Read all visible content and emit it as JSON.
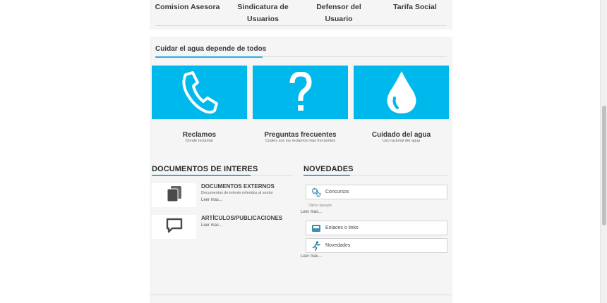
{
  "top_nav": {
    "items": [
      {
        "label": "Comision Asesora"
      },
      {
        "label": "Sindicatura de Usuarios"
      },
      {
        "label": "Defensor del Usuario"
      },
      {
        "label": "Tarifa Social"
      }
    ]
  },
  "care": {
    "title": "Cuidar el agua depende de todos",
    "cards": [
      {
        "icon": "phone-icon",
        "title": "Reclamos",
        "subtitle": "Donde reclamar"
      },
      {
        "icon": "question-icon",
        "title": "Preguntas frecuentes",
        "subtitle": "Cuales son los reclamos mas frecuentes"
      },
      {
        "icon": "water-drop-icon",
        "title": "Cuidado del agua",
        "subtitle": "Uso racional del agua"
      }
    ]
  },
  "documents": {
    "heading": "DOCUMENTOS DE INTERES",
    "items": [
      {
        "icon": "folder-icon",
        "title": "DOCUMENTOS EXTERNOS",
        "description": "Documentos de interés referidos al sector",
        "read_more": "Leer mas..."
      },
      {
        "icon": "speech-bubble-icon",
        "title": "ARTÍCULOS/PUBLICACIONES",
        "description": "",
        "read_more": "Leer mas..."
      }
    ]
  },
  "news": {
    "heading": "NOVEDADES",
    "items": [
      {
        "icon": "gears-icon",
        "label": "Concursos"
      },
      {
        "icon": "inbox-icon",
        "label": "Enlaces o links"
      },
      {
        "icon": "running-person-icon",
        "label": "Novedades"
      }
    ],
    "last_call_note": "Último llamado",
    "read_more_1": "Leer mas...",
    "read_more_2": "Leer mas..."
  },
  "colors": {
    "accent": "#00b9ec",
    "accent_line": "#29aee8",
    "panel_bg": "#f5f5f5"
  }
}
